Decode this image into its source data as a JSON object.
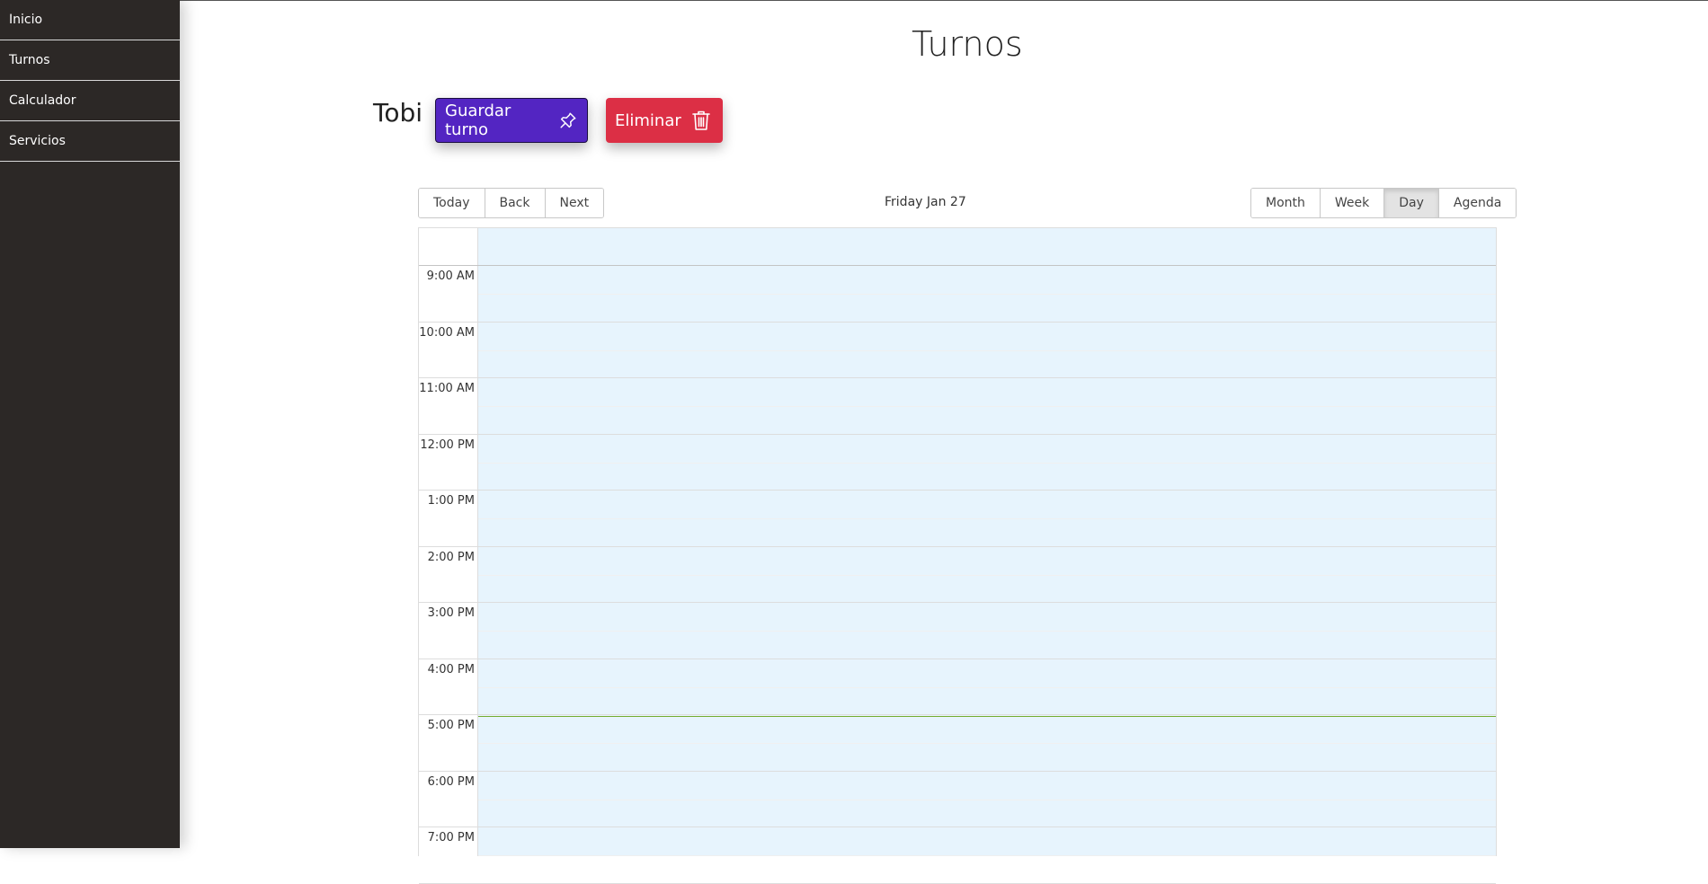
{
  "sidebar": {
    "items": [
      {
        "label": "Inicio"
      },
      {
        "label": "Turnos"
      },
      {
        "label": "Calculador"
      },
      {
        "label": "Servicios"
      }
    ]
  },
  "page": {
    "title": "Turnos",
    "client_name": "Tobi"
  },
  "actions": {
    "save_label": "Guardar turno",
    "save_icon": "pin-icon",
    "save_color": "#5325c2",
    "delete_label": "Eliminar",
    "delete_icon": "trash-icon",
    "delete_color": "#dc2f45"
  },
  "calendar": {
    "nav": {
      "today": "Today",
      "back": "Back",
      "next": "Next"
    },
    "date_label": "Friday Jan 27",
    "views": {
      "month": "Month",
      "week": "Week",
      "day": "Day",
      "agenda": "Agenda"
    },
    "active_view": "Day",
    "times": [
      "9:00 AM",
      "10:00 AM",
      "11:00 AM",
      "12:00 PM",
      "1:00 PM",
      "2:00 PM",
      "3:00 PM",
      "4:00 PM",
      "5:00 PM",
      "6:00 PM",
      "7:00 PM"
    ],
    "now_indicator_color": "#74ad31",
    "slot_bg_color": "#e7f4fd"
  }
}
